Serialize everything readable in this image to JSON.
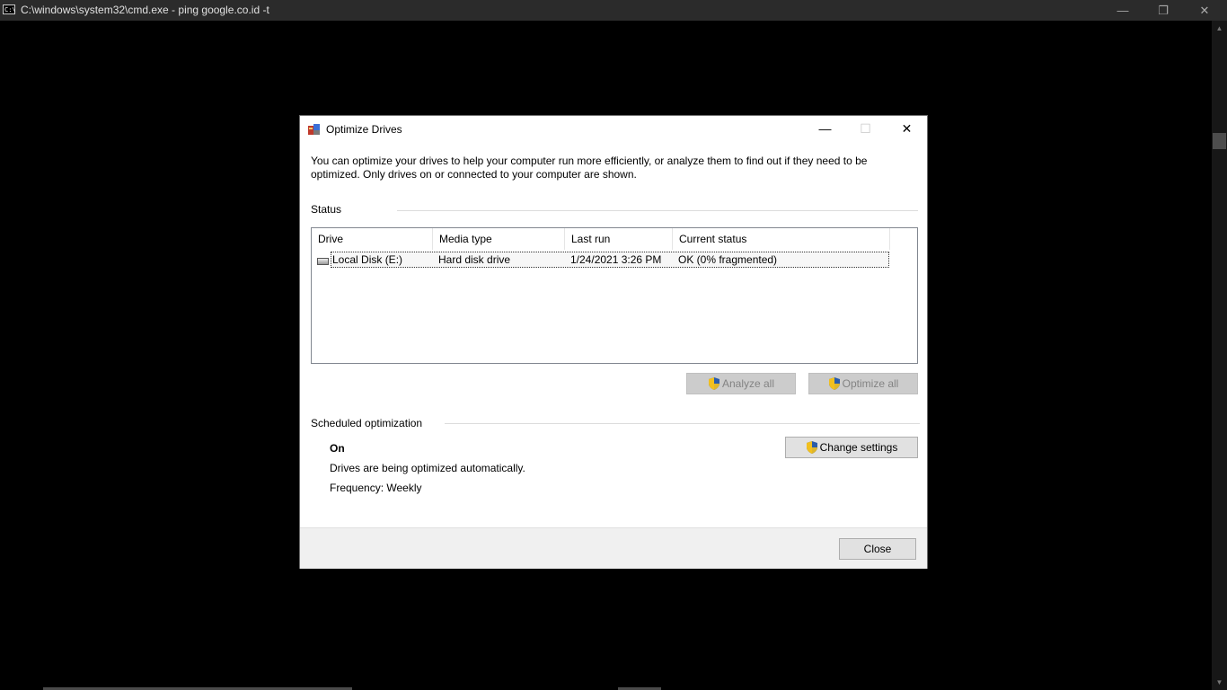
{
  "cmd": {
    "title": "C:\\windows\\system32\\cmd.exe - ping  google.co.id -t",
    "icon_text": "C:\\",
    "controls": {
      "minimize": "—",
      "restore": "❐",
      "close": "✕"
    }
  },
  "dialog": {
    "title": "Optimize Drives",
    "controls": {
      "minimize": "—",
      "maximize": "☐",
      "close": "✕"
    },
    "description": "You can optimize your drives to help your computer run more efficiently, or analyze them to find out if they need to be optimized. Only drives on or connected to your computer are shown.",
    "status_label": "Status",
    "columns": [
      "Drive",
      "Media type",
      "Last run",
      "Current status"
    ],
    "drives": [
      {
        "drive": "Local Disk (E:)",
        "media_type": "Hard disk drive",
        "last_run": "1/24/2021 3:26 PM",
        "current_status": "OK (0% fragmented)"
      }
    ],
    "analyze_all": "Analyze all",
    "optimize_all": "Optimize all",
    "scheduled_label": "Scheduled optimization",
    "schedule_state": "On",
    "schedule_desc": "Drives are being optimized automatically.",
    "frequency": "Frequency: Weekly",
    "change_settings": "Change settings",
    "close_button": "Close"
  },
  "colors": {
    "shield_blue": "#2a5caa",
    "shield_yellow": "#f2c01e"
  },
  "icons": [
    "cmd-icon",
    "defrag-icon",
    "drive-icon",
    "shield-icon"
  ]
}
